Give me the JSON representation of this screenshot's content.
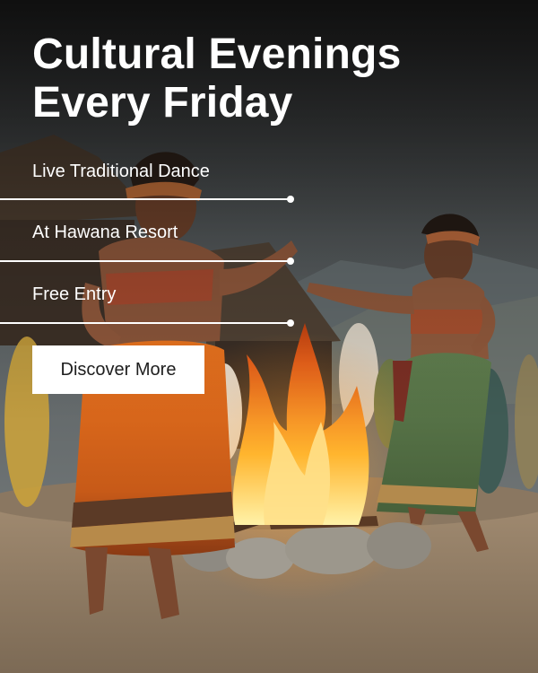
{
  "headline": {
    "line1": "Cultural Evenings",
    "line2": "Every Friday"
  },
  "features": [
    {
      "label": "Live Traditional Dance"
    },
    {
      "label": "At Hawana Resort"
    },
    {
      "label": "Free Entry"
    }
  ],
  "cta": {
    "label": "Discover More"
  },
  "colors": {
    "text": "#ffffff",
    "button_bg": "#ffffff",
    "button_text": "#1e1e1e",
    "fire": "#f08a1c"
  }
}
